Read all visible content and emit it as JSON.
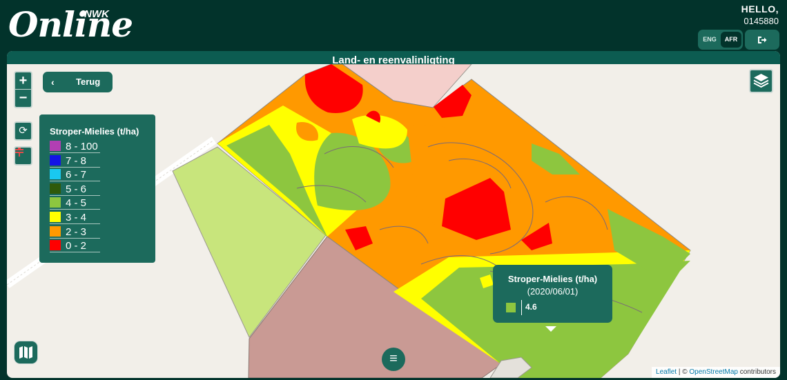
{
  "header": {
    "logo_main": "Online",
    "logo_sub": "NWK",
    "greeting": "HELLO,",
    "user_id": "0145880",
    "lang_eng": "ENG",
    "lang_afr": "AFR",
    "active_language": "AFR",
    "logout_icon": "sign-out-icon"
  },
  "page": {
    "title": "Land- en reenvalinligting"
  },
  "map_controls": {
    "zoom_in": "+",
    "zoom_out": "−",
    "back_label": "Terug",
    "back_icon": "chevron-left-icon",
    "refresh_icon": "refresh-icon",
    "filter_icon": "filter-icon",
    "layers_icon": "layers-icon",
    "maps_icon": "map-icon",
    "menu_icon": "hamburger-menu-icon"
  },
  "legend": {
    "title": "Stroper-Mielies (t/ha)",
    "items": [
      {
        "label": "8 - 100",
        "color": "#b23fb3"
      },
      {
        "label": "7 - 8",
        "color": "#1414e6"
      },
      {
        "label": "6 - 7",
        "color": "#19c8f0"
      },
      {
        "label": "5 - 6",
        "color": "#2f5a0a"
      },
      {
        "label": "4 - 5",
        "color": "#8dc63f"
      },
      {
        "label": "3 - 4",
        "color": "#ffff00"
      },
      {
        "label": "2 - 3",
        "color": "#ff9900"
      },
      {
        "label": "0 - 2",
        "color": "#ff0000"
      }
    ]
  },
  "popup": {
    "title": "Stroper-Mielies (t/ha)",
    "date": "(2020/06/01)",
    "value": "4.6",
    "swatch_color": "#8dc63f"
  },
  "attribution": {
    "leaflet": "Leaflet",
    "separator": " | © ",
    "osm": "OpenStreetMap",
    "suffix": " contributors"
  },
  "colors": {
    "header_bg": "#02332b",
    "panel_bg": "#1c6a5c",
    "map_bg": "#f2efe9"
  }
}
